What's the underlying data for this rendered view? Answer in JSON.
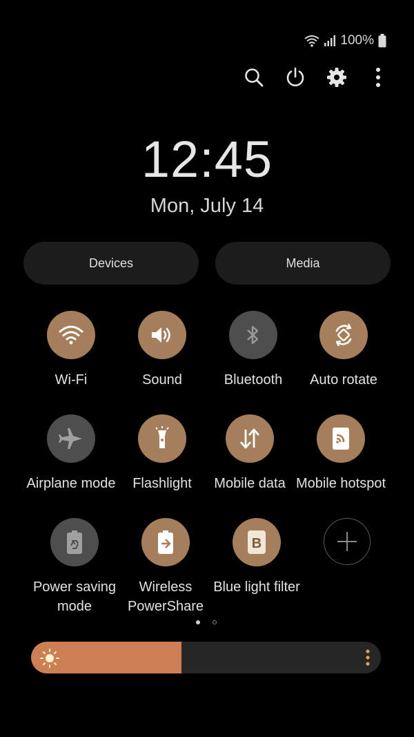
{
  "status_bar": {
    "battery_text": "100%"
  },
  "top_actions": [
    {
      "name": "search-button",
      "icon": "search-icon"
    },
    {
      "name": "power-button",
      "icon": "power-icon"
    },
    {
      "name": "settings-button",
      "icon": "gear-icon"
    },
    {
      "name": "more-options-button",
      "icon": "more-vertical-icon"
    }
  ],
  "clock": {
    "time": "12:45",
    "date": "Mon, July 14"
  },
  "buttons": {
    "devices": "Devices",
    "media": "Media"
  },
  "tiles": [
    {
      "label": "Wi-Fi",
      "state": "on",
      "icon": "wifi-icon"
    },
    {
      "label": "Sound",
      "state": "on",
      "icon": "speaker-icon"
    },
    {
      "label": "Bluetooth",
      "state": "off",
      "icon": "bluetooth-icon"
    },
    {
      "label": "Auto rotate",
      "state": "on",
      "icon": "rotate-icon"
    },
    {
      "label": "Airplane mode",
      "state": "off",
      "icon": "airplane-icon"
    },
    {
      "label": "Flashlight",
      "state": "on",
      "icon": "flashlight-icon"
    },
    {
      "label": "Mobile data",
      "state": "on",
      "icon": "data-arrows-icon"
    },
    {
      "label": "Mobile hotspot",
      "state": "on",
      "icon": "hotspot-icon"
    },
    {
      "label": "Power saving mode",
      "state": "off",
      "icon": "battery-recycle-icon"
    },
    {
      "label": "Wireless PowerShare",
      "state": "on",
      "icon": "battery-share-icon"
    },
    {
      "label": "Blue light filter",
      "state": "on",
      "icon": "blue-light-icon"
    },
    {
      "label": "",
      "state": "add",
      "icon": "plus-icon"
    }
  ],
  "page_indicator": {
    "pages": 2,
    "current": 1
  },
  "brightness": {
    "level": 0.43
  },
  "colors": {
    "accent": "#a57f5c",
    "off": "#4e4e4e",
    "brightness_fill": "#cd7f54"
  }
}
